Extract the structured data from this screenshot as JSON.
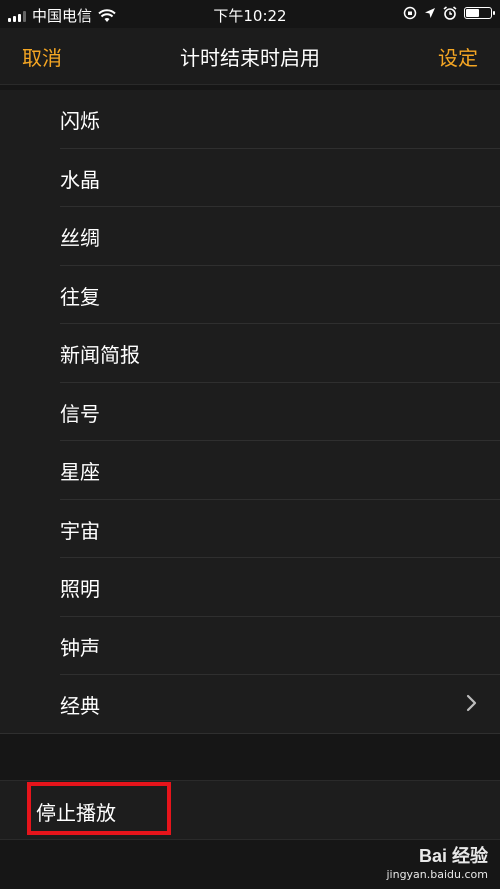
{
  "status_bar": {
    "carrier": "中国电信",
    "time": "下午10:22"
  },
  "nav": {
    "cancel": "取消",
    "title": "计时结束时启用",
    "set": "设定"
  },
  "sounds": [
    {
      "label": "闪烁"
    },
    {
      "label": "水晶"
    },
    {
      "label": "丝绸"
    },
    {
      "label": "往复"
    },
    {
      "label": "新闻简报"
    },
    {
      "label": "信号"
    },
    {
      "label": "星座"
    },
    {
      "label": "宇宙"
    },
    {
      "label": "照明"
    },
    {
      "label": "钟声"
    },
    {
      "label": "经典"
    }
  ],
  "stop_playing": "停止播放",
  "watermark": {
    "brand": "Bai 经验",
    "url": "jingyan.baidu.com"
  }
}
